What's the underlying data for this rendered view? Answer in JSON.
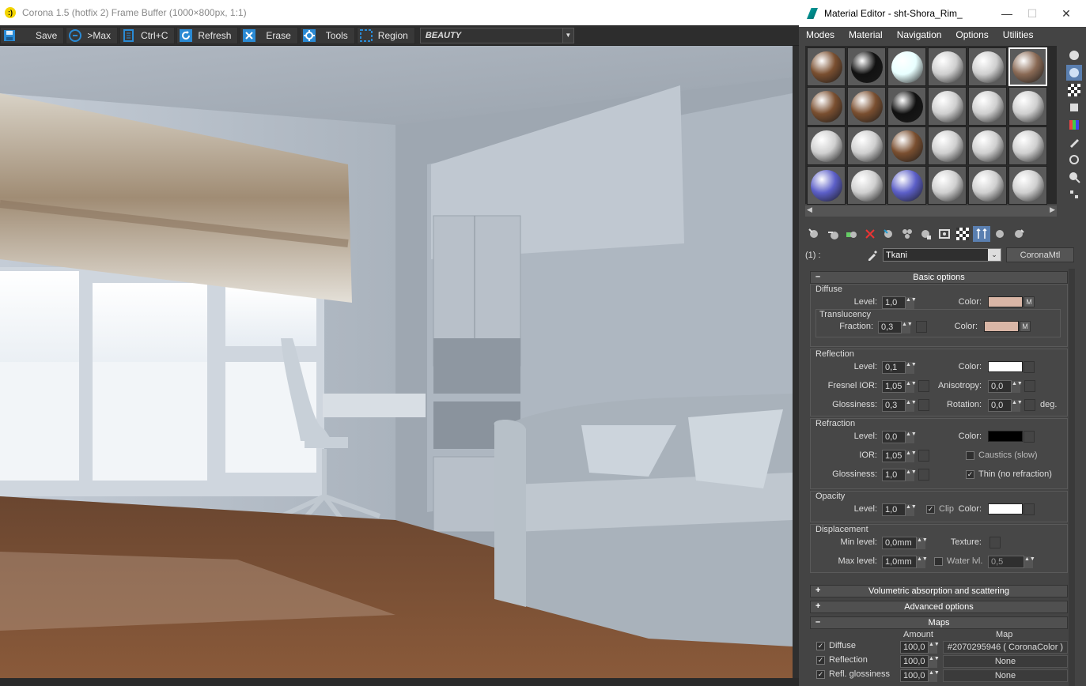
{
  "framebuffer": {
    "title": "Corona 1.5 (hotfix 2) Frame Buffer (1000×800px, 1:1)",
    "toolbar": {
      "save": "Save",
      "max": ">Max",
      "copy": "Ctrl+C",
      "refresh": "Refresh",
      "erase": "Erase",
      "tools": "Tools",
      "region": "Region",
      "pass": "BEAUTY"
    }
  },
  "material_editor": {
    "title": "Material Editor - sht-Shora_Rim_",
    "menu": [
      "Modes",
      "Material",
      "Navigation",
      "Options",
      "Utilities"
    ],
    "slot_colors": [
      [
        "#7a4f30",
        "#111111",
        "#e8ffff",
        "#cfcfcf",
        "#cfcfcf",
        "#8a6a55"
      ],
      [
        "#7a4f30",
        "#7a4f30",
        "#111111",
        "#cfcfcf",
        "#cfcfcf",
        "#cfcfcf"
      ],
      [
        "#cfcfcf",
        "#cfcfcf",
        "#7a4f30",
        "#cfcfcf",
        "#cfcfcf",
        "#cfcfcf"
      ],
      [
        "#5c5fc8",
        "#cfcfcf",
        "#5c5fc8",
        "#cfcfcf",
        "#cfcfcf",
        "#cfcfcf"
      ]
    ],
    "slot_index_label": "(1) :",
    "material_name": "Tkani",
    "material_type": "CoronaMtl",
    "basic_options": {
      "header": "Basic options",
      "diffuse": {
        "group": "Diffuse",
        "level_label": "Level:",
        "level": "1,0",
        "color_label": "Color:",
        "color": "#d9b6a6",
        "map_btn": "M",
        "translucency": {
          "group": "Translucency",
          "fraction_label": "Fraction:",
          "fraction": "0,3",
          "color_label": "Color:",
          "color": "#d9b6a6",
          "map_btn": "M"
        }
      },
      "reflection": {
        "group": "Reflection",
        "level_label": "Level:",
        "level": "0,1",
        "color_label": "Color:",
        "color": "#ffffff",
        "fresnel_label": "Fresnel IOR:",
        "fresnel": "1,05",
        "aniso_label": "Anisotropy:",
        "aniso": "0,0",
        "gloss_label": "Glossiness:",
        "gloss": "0,3",
        "rotation_label": "Rotation:",
        "rotation": "0,0",
        "deg": "deg."
      },
      "refraction": {
        "group": "Refraction",
        "level_label": "Level:",
        "level": "0,0",
        "color_label": "Color:",
        "color": "#000000",
        "ior_label": "IOR:",
        "ior": "1,05",
        "caustics": "Caustics (slow)",
        "gloss_label": "Glossiness:",
        "gloss": "1,0",
        "thin": "Thin (no refraction)"
      },
      "opacity": {
        "group": "Opacity",
        "level_label": "Level:",
        "level": "1,0",
        "clip": "Clip",
        "color_label": "Color:",
        "color": "#ffffff"
      },
      "displacement": {
        "group": "Displacement",
        "min_label": "Min level:",
        "min": "0,0mm",
        "texture_label": "Texture:",
        "max_label": "Max level:",
        "max": "1,0mm",
        "water_label": "Water lvl.",
        "water": "0,5"
      }
    },
    "volumetric_header": "Volumetric absorption and scattering",
    "advanced_header": "Advanced options",
    "maps": {
      "header": "Maps",
      "amount_col": "Amount",
      "map_col": "Map",
      "rows": [
        {
          "name": "Diffuse",
          "amount": "100,0",
          "map": "#2070295946  ( CoronaColor )"
        },
        {
          "name": "Reflection",
          "amount": "100,0",
          "map": "None"
        },
        {
          "name": "Refl. glossiness",
          "amount": "100,0",
          "map": "None"
        }
      ]
    }
  }
}
